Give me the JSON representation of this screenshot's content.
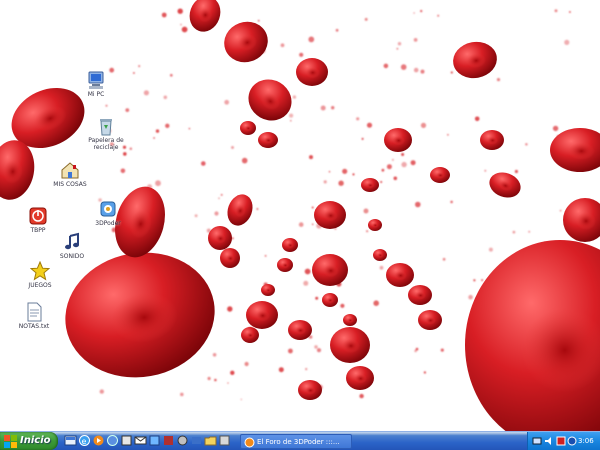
{
  "desktop": {
    "wallpaper": "red-blood-cells",
    "icons": [
      {
        "label": "Mi PC",
        "icon": "my-computer-icon"
      },
      {
        "label": "Papelera de reciclaje",
        "icon": "recycle-bin-icon"
      },
      {
        "label": "MIS COSAS",
        "icon": "folder-home-icon"
      },
      {
        "label": "3DPoder",
        "icon": "program-icon"
      },
      {
        "label": "TBPP",
        "icon": "red-app-icon"
      },
      {
        "label": "SONIDO",
        "icon": "music-note-icon"
      },
      {
        "label": "JUEGOS",
        "icon": "star-icon"
      },
      {
        "label": "NOTAS.txt",
        "icon": "text-file-icon"
      }
    ]
  },
  "taskbar": {
    "start_label": "Inicio",
    "quick_launch": [
      "desktop-icon",
      "ie-icon",
      "media-icon",
      "browser-icon",
      "app-icon",
      "mail-icon",
      "app-icon",
      "app-icon",
      "folder-icon",
      "app-icon",
      "app-icon",
      "app-icon"
    ],
    "task_title": "El Foro de 3DPoder :::...",
    "clock": "3:06"
  },
  "colors": {
    "blood_red": "#c8141c",
    "taskbar_blue": "#2b63c8",
    "start_green": "#3c9a37",
    "tray_blue": "#1a86e0"
  }
}
